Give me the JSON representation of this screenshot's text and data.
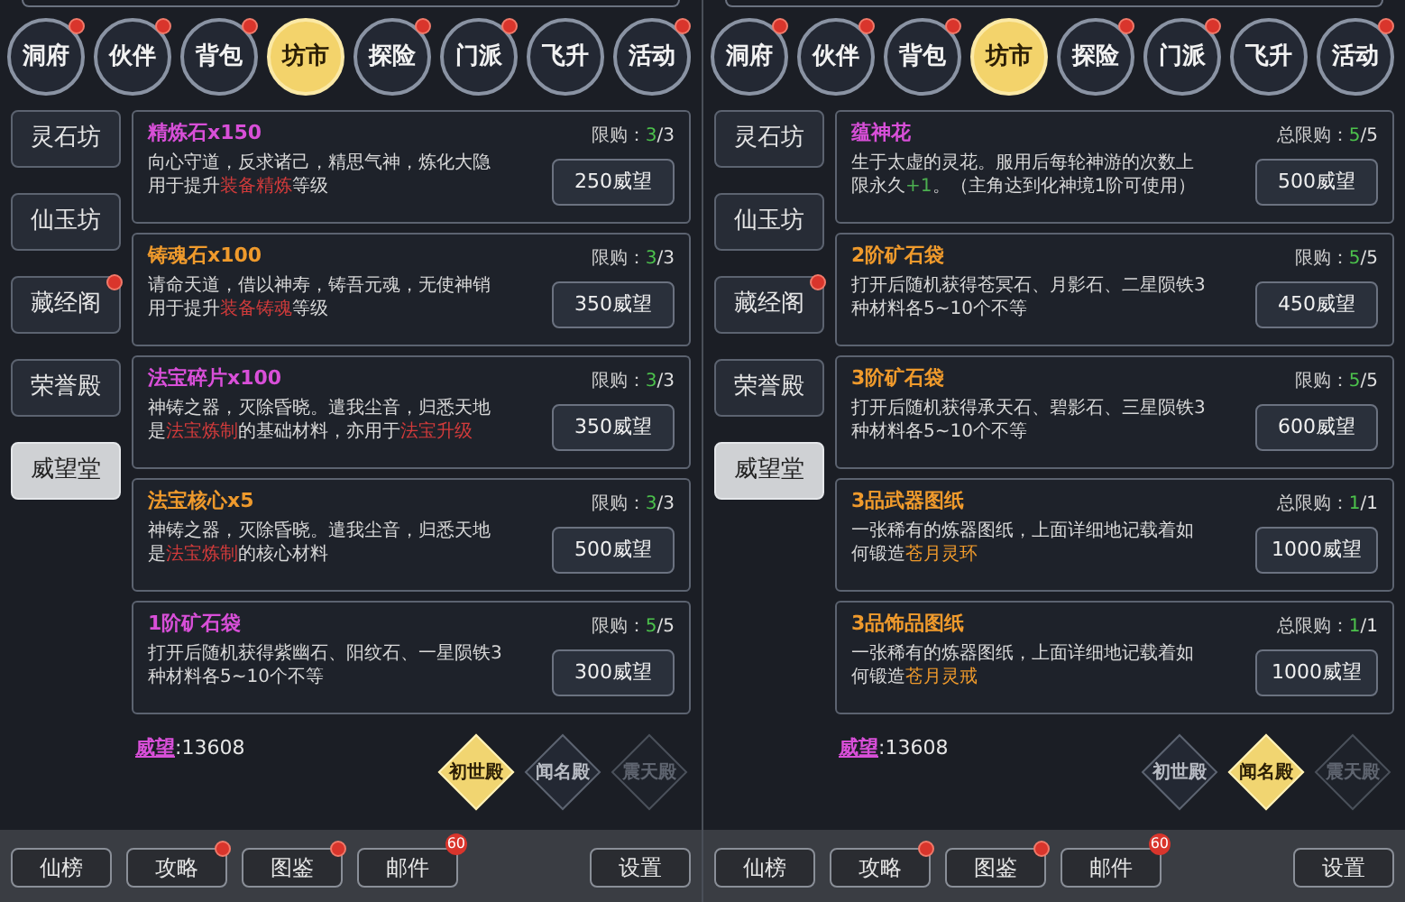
{
  "panels": [
    {
      "tabs": [
        {
          "label": "洞府",
          "selected": false,
          "badge": true
        },
        {
          "label": "伙伴",
          "selected": false,
          "badge": true
        },
        {
          "label": "背包",
          "selected": false,
          "badge": true
        },
        {
          "label": "坊市",
          "selected": true,
          "badge": false
        },
        {
          "label": "探险",
          "selected": false,
          "badge": true
        },
        {
          "label": "门派",
          "selected": false,
          "badge": true
        },
        {
          "label": "飞升",
          "selected": false,
          "badge": false
        },
        {
          "label": "活动",
          "selected": false,
          "badge": true
        }
      ],
      "sidebar": {
        "items": [
          {
            "label": "灵石坊",
            "selected": false,
            "badge": false
          },
          {
            "label": "仙玉坊",
            "selected": false,
            "badge": false
          },
          {
            "label": "藏经阁",
            "selected": false,
            "badge": true
          },
          {
            "label": "荣誉殿",
            "selected": false,
            "badge": false
          },
          {
            "label": "威望堂",
            "selected": true,
            "badge": false
          }
        ]
      },
      "items": [
        {
          "name": "精炼石x150",
          "color": "#d84fd8",
          "limit_label": "限购：",
          "limit_count": "3",
          "limit_rest": "/3",
          "description": [
            {
              "text": "向心守道，反求诸己，精思气神，炼化大隐用于提升"
            },
            {
              "text": "装备精炼",
              "color": "#d23b3b"
            },
            {
              "text": "等级"
            }
          ],
          "price": "250威望"
        },
        {
          "name": "铸魂石x100",
          "color": "#ef9a2c",
          "limit_label": "限购：",
          "limit_count": "3",
          "limit_rest": "/3",
          "description": [
            {
              "text": "请命天道，借以神寿，铸吾元魂，无使神销用于提升"
            },
            {
              "text": "装备铸魂",
              "color": "#d23b3b"
            },
            {
              "text": "等级"
            }
          ],
          "price": "350威望"
        },
        {
          "name": "法宝碎片x100",
          "color": "#d84fd8",
          "limit_label": "限购：",
          "limit_count": "3",
          "limit_rest": "/3",
          "description": [
            {
              "text": "神铸之器，灭除昏晓。遣我尘音，归悉天地是"
            },
            {
              "text": "法宝炼制",
              "color": "#d23b3b"
            },
            {
              "text": "的基础材料，亦用于"
            },
            {
              "text": "法宝升级",
              "color": "#d23b3b"
            }
          ],
          "price": "350威望"
        },
        {
          "name": "法宝核心x5",
          "color": "#ef9a2c",
          "limit_label": "限购：",
          "limit_count": "3",
          "limit_rest": "/3",
          "description": [
            {
              "text": "神铸之器，灭除昏晓。遣我尘音，归悉天地是"
            },
            {
              "text": "法宝炼制",
              "color": "#d23b3b"
            },
            {
              "text": "的核心材料"
            }
          ],
          "price": "500威望"
        },
        {
          "name": "1阶矿石袋",
          "color": "#d84fd8",
          "limit_label": "限购：",
          "limit_count": "5",
          "limit_rest": "/5",
          "description": [
            {
              "text": "打开后随机获得紫幽石、阳纹石、一星陨铁3种材料各5~10个不等"
            }
          ],
          "price": "300威望"
        }
      ],
      "currency": {
        "label": "威望",
        "value": ":13608"
      },
      "halls": [
        {
          "label": "初世殿",
          "selected": true,
          "disabled": false
        },
        {
          "label": "闻名殿",
          "selected": false,
          "disabled": false
        },
        {
          "label": "震天殿",
          "selected": false,
          "disabled": true
        }
      ],
      "bottom_bar": [
        {
          "label": "仙榜",
          "badge": false
        },
        {
          "label": "攻略",
          "badge": true
        },
        {
          "label": "图鉴",
          "badge": true
        },
        {
          "label": "邮件",
          "badge": true,
          "count": "60"
        },
        {
          "label": "设置",
          "badge": false
        }
      ]
    },
    {
      "tabs": [
        {
          "label": "洞府",
          "selected": false,
          "badge": true
        },
        {
          "label": "伙伴",
          "selected": false,
          "badge": true
        },
        {
          "label": "背包",
          "selected": false,
          "badge": true
        },
        {
          "label": "坊市",
          "selected": true,
          "badge": false
        },
        {
          "label": "探险",
          "selected": false,
          "badge": true
        },
        {
          "label": "门派",
          "selected": false,
          "badge": true
        },
        {
          "label": "飞升",
          "selected": false,
          "badge": false
        },
        {
          "label": "活动",
          "selected": false,
          "badge": true
        }
      ],
      "sidebar": {
        "items": [
          {
            "label": "灵石坊",
            "selected": false,
            "badge": false
          },
          {
            "label": "仙玉坊",
            "selected": false,
            "badge": false
          },
          {
            "label": "藏经阁",
            "selected": false,
            "badge": true
          },
          {
            "label": "荣誉殿",
            "selected": false,
            "badge": false
          },
          {
            "label": "威望堂",
            "selected": true,
            "badge": false
          }
        ]
      },
      "items": [
        {
          "name": "蕴神花",
          "color": "#d84fd8",
          "limit_label": "总限购：",
          "limit_count": "5",
          "limit_rest": "/5",
          "description": [
            {
              "text": "生于太虚的灵花。服用后每轮神游的次数上限永久"
            },
            {
              "text": "+1",
              "color": "#4caf50"
            },
            {
              "text": "。（主角达到化神境1阶可使用）"
            }
          ],
          "price": "500威望"
        },
        {
          "name": "2阶矿石袋",
          "color": "#ef9a2c",
          "limit_label": "限购：",
          "limit_count": "5",
          "limit_rest": "/5",
          "description": [
            {
              "text": "打开后随机获得苍冥石、月影石、二星陨铁3种材料各5~10个不等"
            }
          ],
          "price": "450威望"
        },
        {
          "name": "3阶矿石袋",
          "color": "#ef9a2c",
          "limit_label": "限购：",
          "limit_count": "5",
          "limit_rest": "/5",
          "description": [
            {
              "text": "打开后随机获得承天石、碧影石、三星陨铁3种材料各5~10个不等"
            }
          ],
          "price": "600威望"
        },
        {
          "name": "3品武器图纸",
          "color": "#ef9a2c",
          "limit_label": "总限购：",
          "limit_count": "1",
          "limit_rest": "/1",
          "description": [
            {
              "text": "一张稀有的炼器图纸，上面详细地记载着如何锻造"
            },
            {
              "text": "苍月灵环",
              "color": "#ef9a2c"
            }
          ],
          "price": "1000威望"
        },
        {
          "name": "3品饰品图纸",
          "color": "#ef9a2c",
          "limit_label": "总限购：",
          "limit_count": "1",
          "limit_rest": "/1",
          "description": [
            {
              "text": "一张稀有的炼器图纸，上面详细地记载着如何锻造"
            },
            {
              "text": "苍月灵戒",
              "color": "#ef9a2c"
            }
          ],
          "price": "1000威望"
        }
      ],
      "currency": {
        "label": "威望",
        "value": ":13608"
      },
      "halls": [
        {
          "label": "初世殿",
          "selected": false,
          "disabled": false
        },
        {
          "label": "闻名殿",
          "selected": true,
          "disabled": false
        },
        {
          "label": "震天殿",
          "selected": false,
          "disabled": true
        }
      ],
      "bottom_bar": [
        {
          "label": "仙榜",
          "badge": false
        },
        {
          "label": "攻略",
          "badge": true
        },
        {
          "label": "图鉴",
          "badge": true
        },
        {
          "label": "邮件",
          "badge": true,
          "count": "60"
        },
        {
          "label": "设置",
          "badge": false
        }
      ]
    }
  ]
}
